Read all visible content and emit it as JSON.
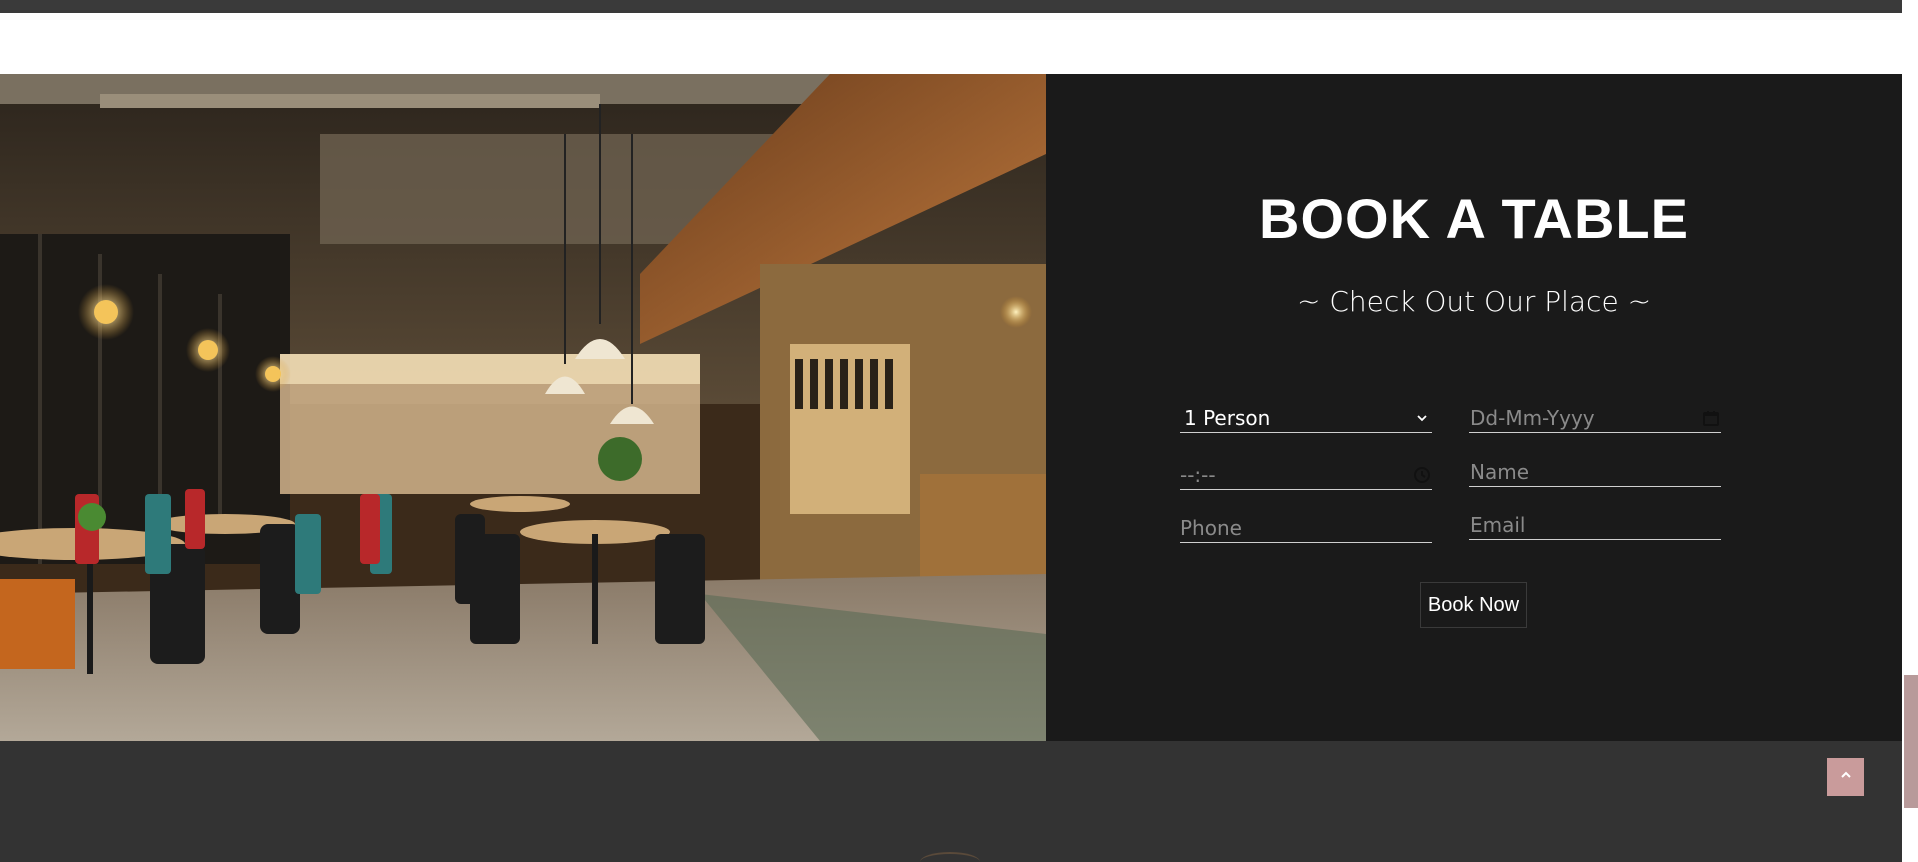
{
  "booking": {
    "title": "BOOK A TABLE",
    "subtitle": "~ Check Out Our Place ~",
    "party_size": {
      "value": "1 Person"
    },
    "date": {
      "placeholder": "Dd-Mm-Yyyy"
    },
    "time": {
      "placeholder": "--:--"
    },
    "name": {
      "placeholder": "Name"
    },
    "phone": {
      "placeholder": "Phone"
    },
    "email": {
      "placeholder": "Email"
    },
    "submit_label": "Book Now"
  },
  "icons": {
    "party_size": "chevron-down-icon",
    "date": "calendar-icon",
    "time": "clock-icon",
    "back_to_top": "chevron-up-icon"
  },
  "colors": {
    "panel_bg": "#1a1a1a",
    "page_bg": "#333333",
    "accent": "#c99b9b"
  }
}
